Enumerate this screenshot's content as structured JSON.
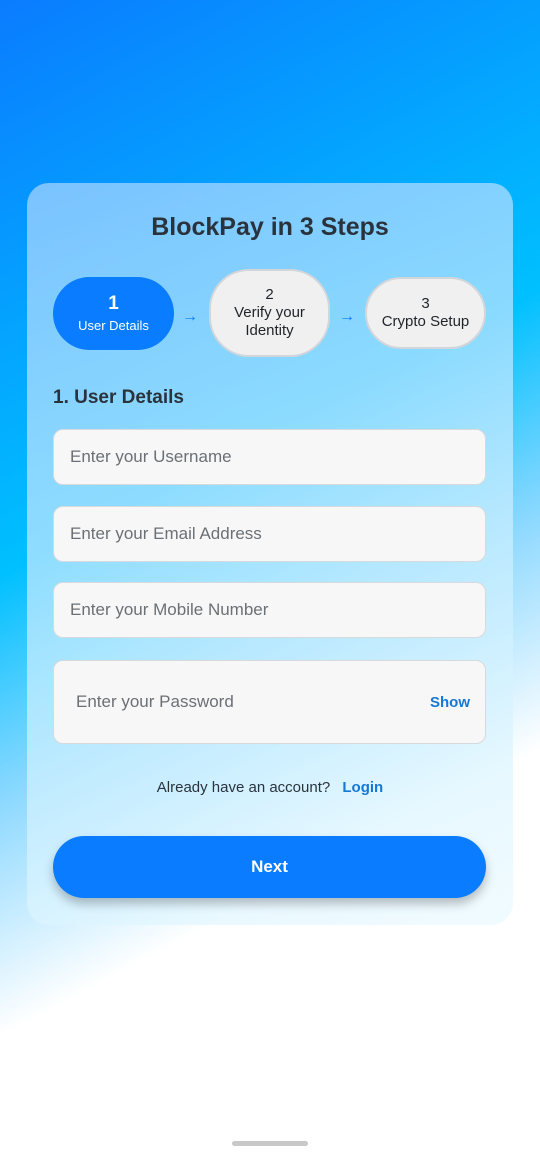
{
  "header": {
    "title": "BlockPay in 3 Steps"
  },
  "steps": [
    {
      "number": "1",
      "label": "User Details"
    },
    {
      "number": "2",
      "label": "Verify your Identity"
    },
    {
      "number": "3",
      "label": "Crypto Setup"
    }
  ],
  "arrow_glyph": "→",
  "section": {
    "title": "1. User Details"
  },
  "form": {
    "username_placeholder": "Enter your Username",
    "email_placeholder": "Enter your Email Address",
    "mobile_placeholder": "Enter your Mobile Number",
    "password_placeholder": "Enter your Password",
    "show_label": "Show"
  },
  "login": {
    "prompt": "Already have an account?",
    "link_label": "Login"
  },
  "next_label": "Next",
  "colors": {
    "accent": "#0a7cff",
    "link": "#1478d4"
  }
}
